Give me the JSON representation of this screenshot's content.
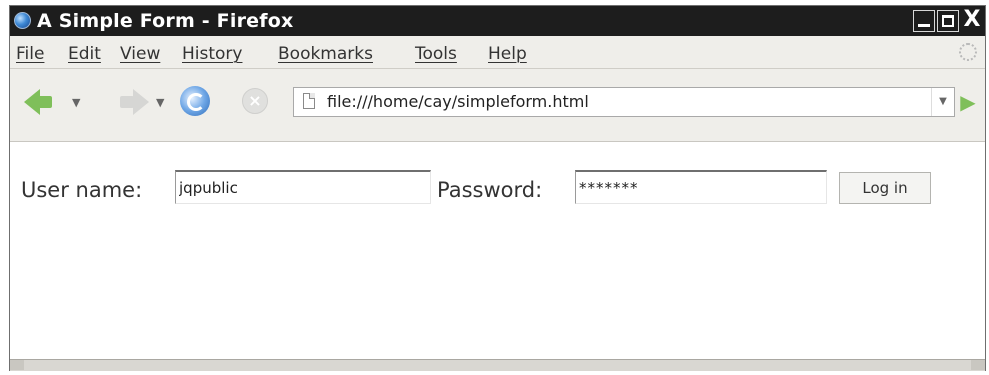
{
  "window": {
    "title": "A Simple Form - Firefox",
    "buttons": {
      "minimize": "_",
      "close": "X"
    }
  },
  "menu": [
    {
      "label": "File"
    },
    {
      "label": "Edit"
    },
    {
      "label": "View"
    },
    {
      "label": "History"
    },
    {
      "label": "Bookmarks"
    },
    {
      "label": "Tools"
    },
    {
      "label": "Help"
    }
  ],
  "navigation": {
    "back_icon": "back-arrow-icon",
    "forward_icon": "forward-arrow-icon",
    "reload_icon": "reload-icon",
    "stop_icon": "stop-icon",
    "url": "file:///home/cay/simpleform.html",
    "go_icon": "go-arrow-icon"
  },
  "form": {
    "username_label": "User name:",
    "username_value": "jqpublic",
    "password_label": "Password:",
    "password_value": "*******",
    "login_button": "Log in"
  },
  "colors": {
    "titlebar": "#1d1d1d",
    "chrome": "#efeeea",
    "green_arrow": "#7fbf5a"
  }
}
